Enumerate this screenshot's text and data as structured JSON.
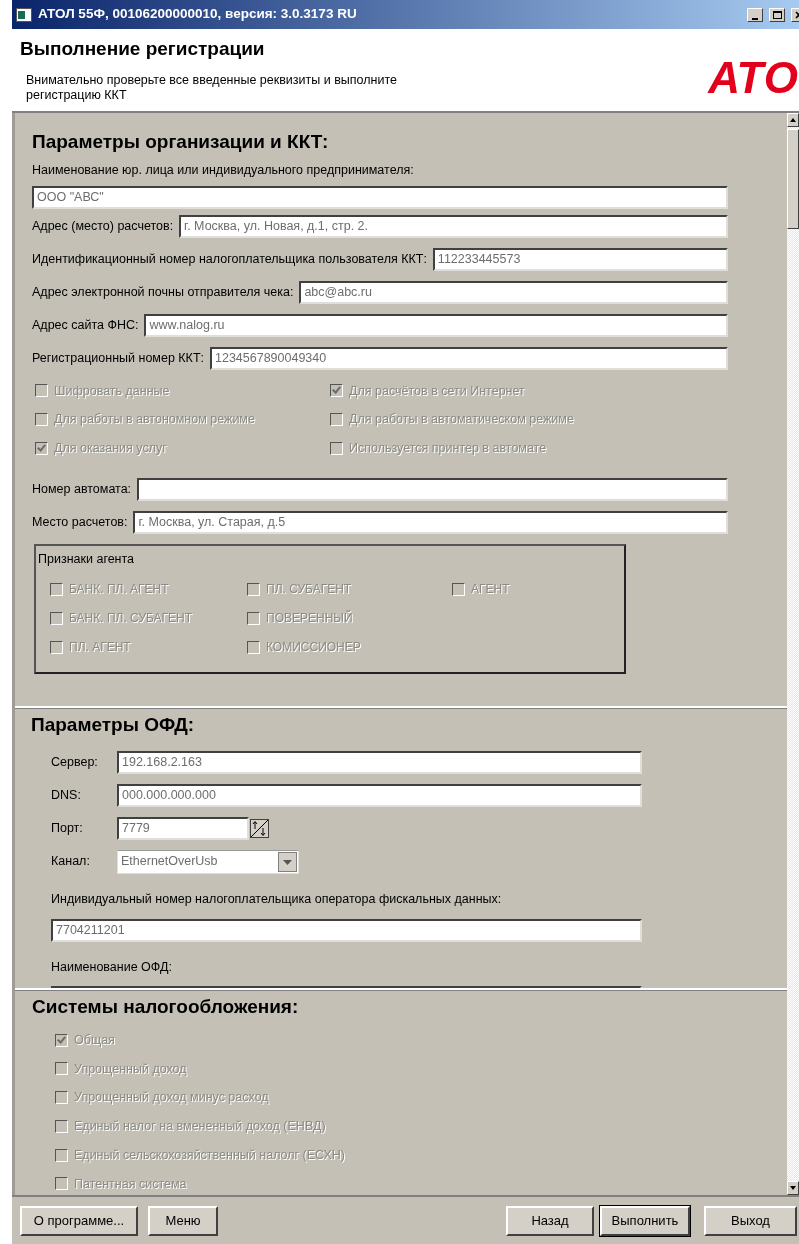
{
  "window": {
    "title": "АТОЛ 55Ф, 00106200000010, версия: 3.0.3173 RU"
  },
  "header": {
    "title": "Выполнение регистрации",
    "description": "Внимательно проверьте все введенные реквизиты и выполните регистрацию ККТ",
    "logo": "АТО"
  },
  "organization": {
    "title": "Параметры организации и ККТ:",
    "fields": [
      {
        "label": "Наименование юр. лица или индивидуального предпринимателя:",
        "value": "ООО \"АВС\"",
        "label_above": true
      },
      {
        "label": "Адрес (место) расчетов:",
        "value": "г. Москва, ул. Новая, д.1, стр. 2.",
        "label_above": false
      },
      {
        "label": "Идентификационный номер налогоплательщика пользователя ККТ:",
        "value": "112233445573",
        "label_above": false
      },
      {
        "label": "Адрес электронной почны отправителя чека:",
        "value": "abc@abc.ru",
        "label_above": false
      },
      {
        "label": "Адрес сайта ФНС:",
        "value": "www.nalog.ru",
        "label_above": false
      },
      {
        "label": "Регистрационный номер ККТ:",
        "value": "1234567890049340",
        "label_above": false
      }
    ],
    "options": [
      {
        "label": "Шифровать данные",
        "checked": false,
        "disabled": true
      },
      {
        "label": "Для расчётов в сети Интернет",
        "checked": true,
        "disabled": true
      },
      {
        "label": "Для работы в автономном режиме",
        "checked": false,
        "disabled": true
      },
      {
        "label": "Для работы в автоматическом режиме",
        "checked": false,
        "disabled": true
      },
      {
        "label": "Для оказания услуг",
        "checked": true,
        "disabled": true
      },
      {
        "label": "Используется принтер в автомате",
        "checked": false,
        "disabled": true
      }
    ],
    "machine_fields": [
      {
        "label": "Номер автомата:",
        "label_above": false
      },
      {
        "label": "Место расчетов:",
        "value": "г. Москва, ул. Старая, д.5",
        "label_above": false
      }
    ],
    "agent_group": {
      "title": "Признаки агента",
      "options": [
        {
          "label": "БАНК. ПЛ. АГЕНТ",
          "checked": false,
          "disabled": true
        },
        {
          "label": "БАНК. ПЛ. СУБАГЕНТ",
          "checked": false,
          "disabled": true
        },
        {
          "label": "ПЛ. АГЕНТ",
          "checked": false,
          "disabled": true
        },
        {
          "label": "ПЛ. СУБАГЕНТ",
          "checked": false,
          "disabled": true
        },
        {
          "label": "ПОВЕРЕННЫЙ",
          "checked": false,
          "disabled": true
        },
        {
          "label": "КОМИССИОНЕР",
          "checked": false,
          "disabled": true
        },
        {
          "label": "АГЕНТ",
          "checked": false,
          "disabled": true
        }
      ]
    }
  },
  "ofd": {
    "title": "Параметры ОФД:",
    "fields": [
      {
        "label": "Сервер:",
        "value": "192.168.2.163",
        "kind": "text",
        "label_above": false
      },
      {
        "label": "DNS:",
        "value": "000.000.000.000",
        "kind": "text",
        "label_above": false
      },
      {
        "label": "Порт:",
        "value": "7779",
        "kind": "spin",
        "label_above": false
      },
      {
        "label": "Канал:",
        "value": "EthernetOverUsb",
        "kind": "dropdown",
        "label_above": false
      },
      {
        "label": "Индивидуальный номер налогоплательщика оператора фискальных данных:",
        "value": "7704211201",
        "kind": "text",
        "label_above": true
      },
      {
        "label": "Наименование ОФД:",
        "kind": "text",
        "label_above": true
      }
    ]
  },
  "taxation": {
    "title": "Системы налогообложения:",
    "options": [
      {
        "label": "Общая",
        "checked": true,
        "disabled": true
      },
      {
        "label": "Упрощенный доход",
        "checked": false,
        "disabled": true
      },
      {
        "label": "Упрощенный доход минус расход",
        "checked": false,
        "disabled": true
      },
      {
        "label": "Единый налог на вмененный доход (ЕНВД)",
        "checked": false,
        "disabled": true
      },
      {
        "label": "Единый сельскохозяйственный налолг (ЕСХН)",
        "checked": false,
        "disabled": true
      },
      {
        "label": "Патентная система",
        "checked": false,
        "disabled": true
      }
    ]
  },
  "buttons_left": [
    {
      "label": "О программе...",
      "default": false
    },
    {
      "label": "Меню",
      "default": false
    }
  ],
  "buttons_right": [
    {
      "label": "Назад",
      "default": false
    },
    {
      "label": "Выполнить",
      "default": true
    },
    {
      "label": "Выход",
      "default": false
    }
  ]
}
